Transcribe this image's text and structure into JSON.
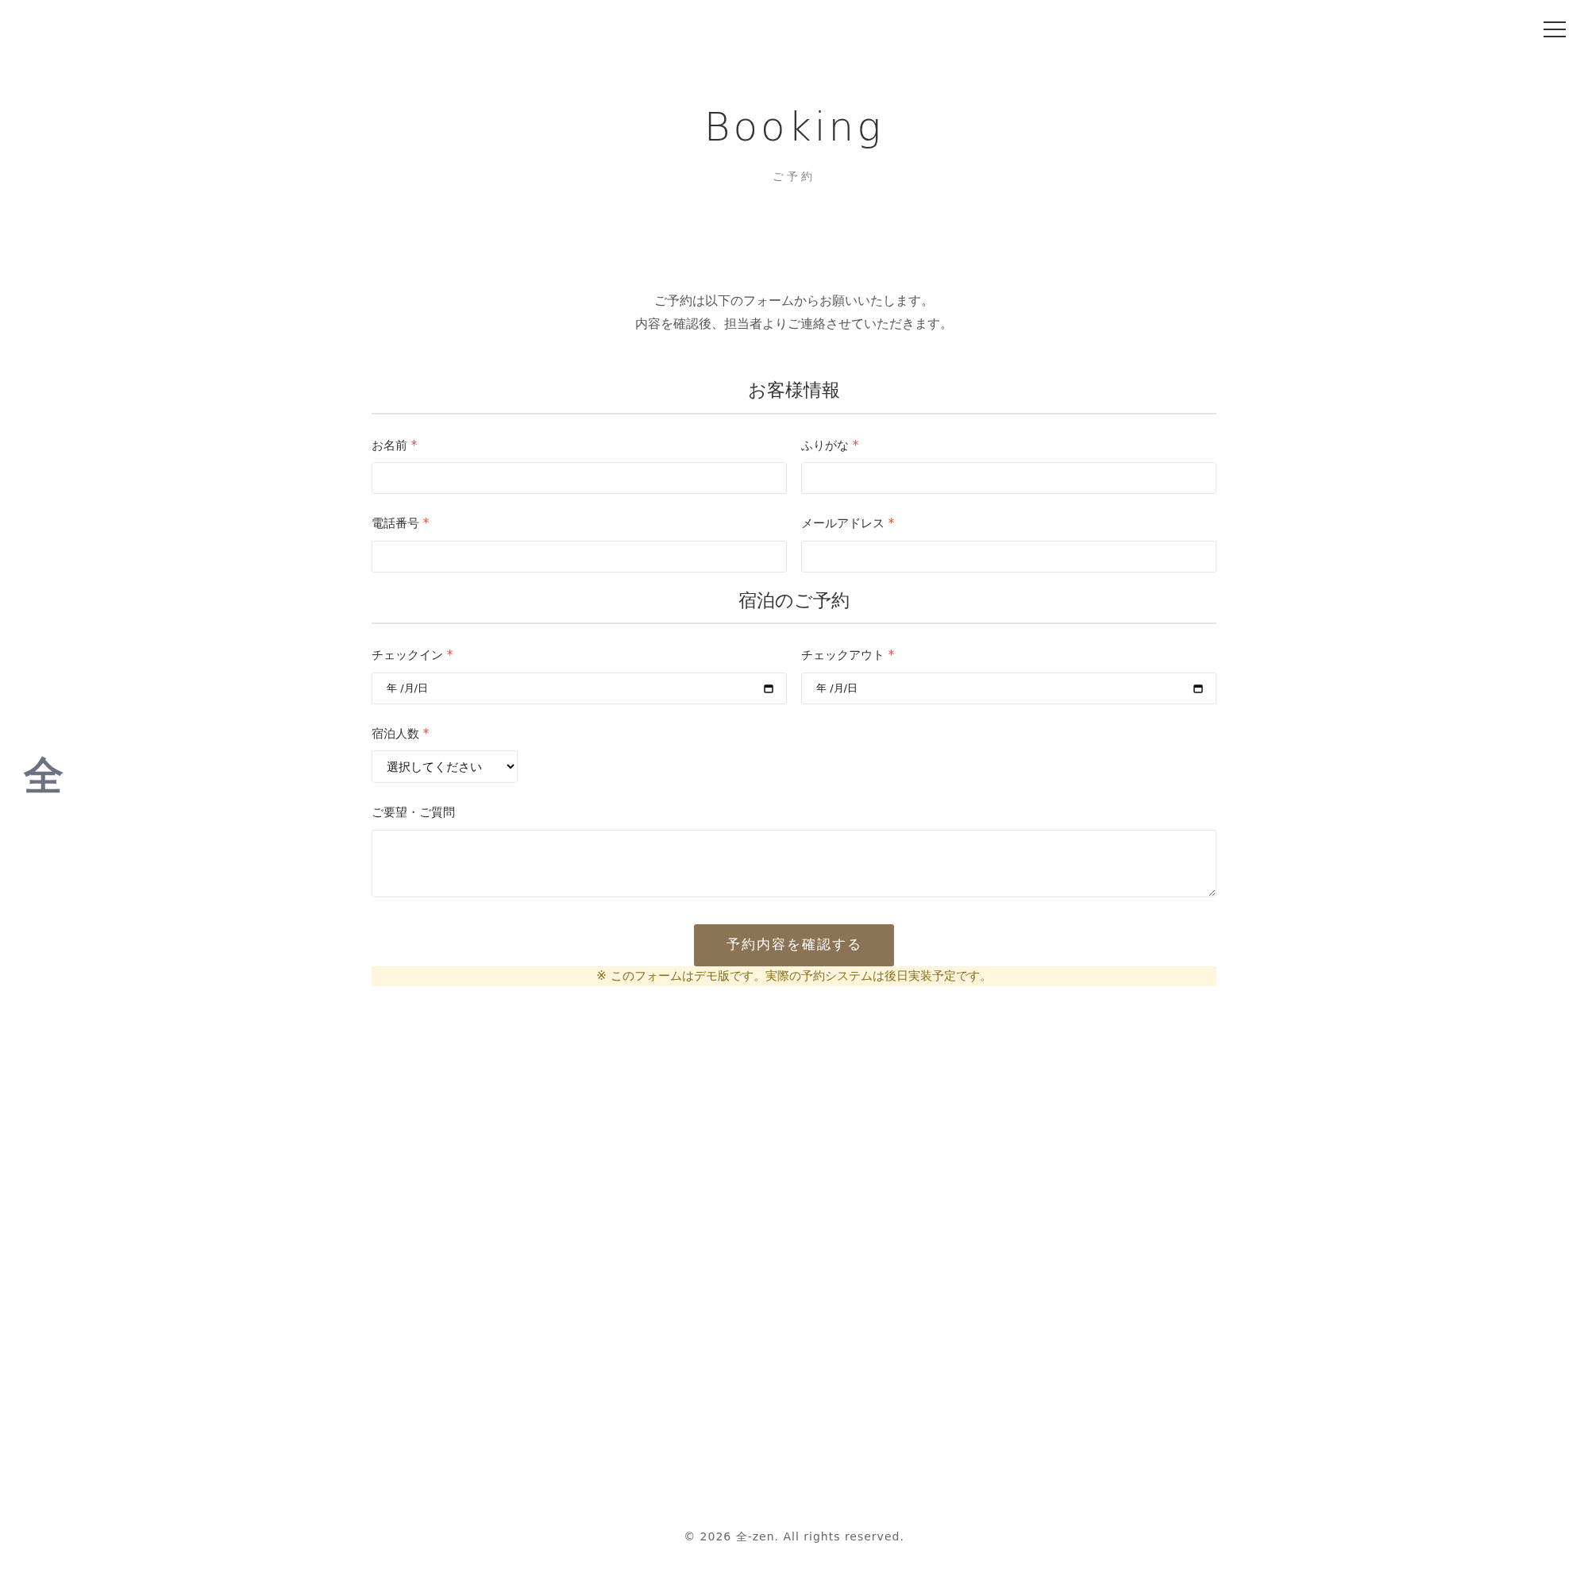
{
  "logo": "全",
  "menu_button": {
    "kind": "hamburger"
  },
  "header": {
    "title": "Booking",
    "subtitle": "ご予約"
  },
  "intro": [
    "ご予約は以下のフォームからお願いいたします。",
    "内容を確認後、担当者よりご連絡させていただきます。"
  ],
  "sections": [
    {
      "heading": "お客様情報",
      "rows": [
        [
          {
            "kind": "text",
            "label": "お名前",
            "required_mark": "*"
          },
          {
            "kind": "text",
            "label": "ふりがな",
            "required_mark": "*"
          }
        ],
        [
          {
            "kind": "text",
            "label": "電話番号",
            "required_mark": "*"
          },
          {
            "kind": "text",
            "label": "メールアドレス",
            "required_mark": "*"
          }
        ]
      ]
    },
    {
      "heading": "宿泊のご予約",
      "rows": [
        [
          {
            "kind": "date",
            "label": "チェックイン",
            "required_mark": "*",
            "value": "年 /月/日"
          },
          {
            "kind": "date",
            "label": "チェックアウト",
            "required_mark": "*",
            "value": "年 /月/日"
          }
        ],
        [
          {
            "kind": "select",
            "label": "宿泊人数",
            "required_mark": "*",
            "value": "選択してください"
          }
        ],
        [
          {
            "kind": "textarea",
            "label": "ご要望・ご質問"
          }
        ]
      ]
    }
  ],
  "submit_button": "予約内容を確認する",
  "notice": "※ このフォームはデモ版です。実際の予約システムは後日実装予定です。",
  "footer": "© 2026 全-zen. All rights reserved."
}
